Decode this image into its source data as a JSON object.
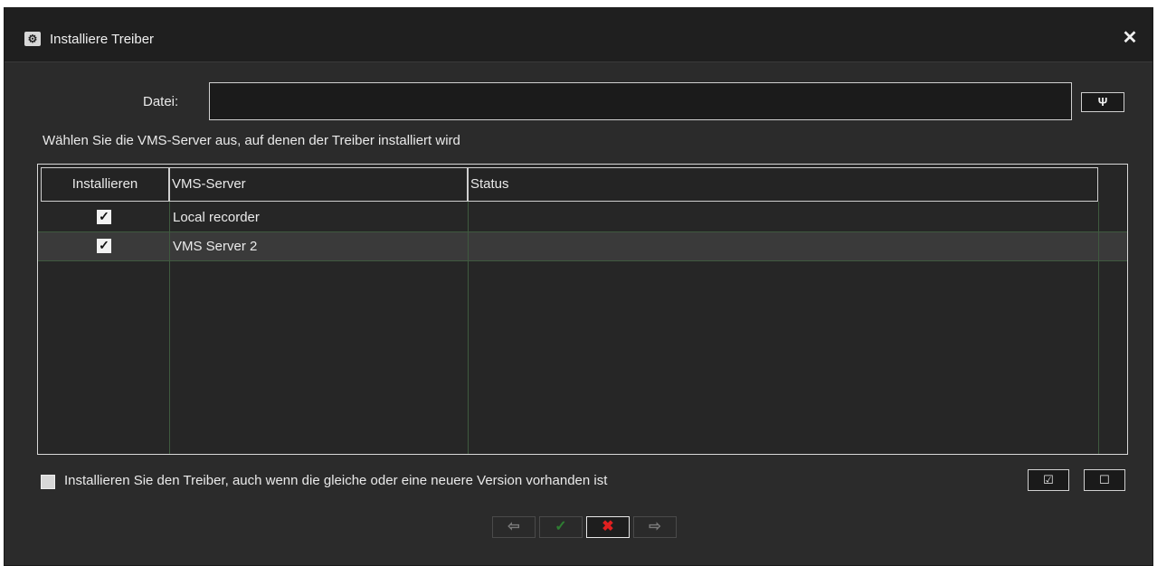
{
  "window": {
    "title": "Installiere Treiber",
    "app_icon": "gears-icon",
    "close_icon": "close-icon"
  },
  "file": {
    "label": "Datei:",
    "value": "",
    "browse_icon": "wrench-icon",
    "browse_glyph": "Ψ"
  },
  "hint": "Wählen Sie die VMS-Server aus, auf denen der Treiber installiert wird",
  "table": {
    "columns": [
      "Installieren",
      "VMS-Server",
      "Status"
    ],
    "rows": [
      {
        "install": true,
        "server": "Local recorder",
        "status": ""
      },
      {
        "install": true,
        "server": "VMS Server 2",
        "status": ""
      }
    ]
  },
  "force_install": {
    "checked": false,
    "label": "Installieren Sie den Treiber, auch wenn die gleiche oder eine neuere Version vorhanden ist"
  },
  "selection_buttons": {
    "select_all_glyph": "☑",
    "select_none_glyph": "☐"
  },
  "navigation": {
    "back_glyph": "⇦",
    "ok_glyph": "✓",
    "cancel_glyph": "✖",
    "next_glyph": "⇨"
  },
  "colors": {
    "background": "#2b2b2b",
    "ok": "#2e7d32",
    "cancel": "#e02020"
  }
}
